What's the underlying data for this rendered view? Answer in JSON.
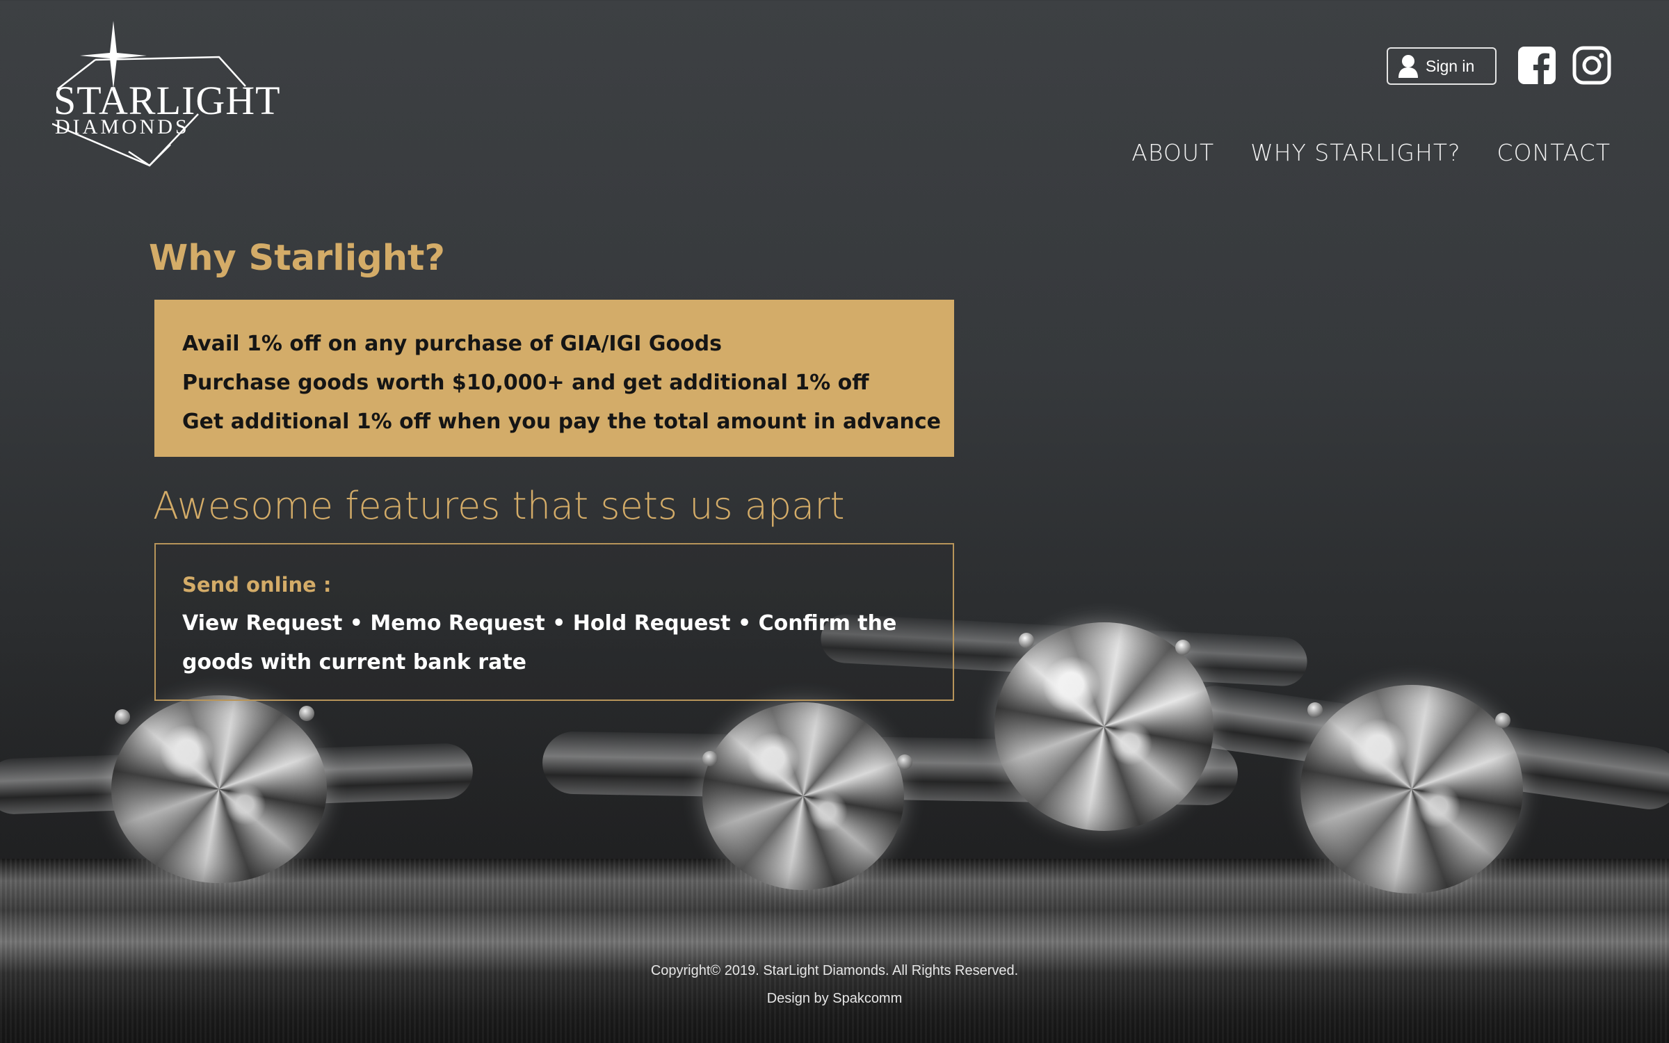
{
  "brand": {
    "title": "STARLIGHT",
    "subtitle": "DIAMONDS",
    "accent_color": "#d4ac68"
  },
  "header": {
    "signin_label": "Sign in",
    "icons": [
      "user-icon",
      "facebook-icon",
      "instagram-icon"
    ]
  },
  "nav": {
    "items": [
      {
        "label": "ABOUT"
      },
      {
        "label": "WHY STARLIGHT?"
      },
      {
        "label": "CONTACT"
      }
    ]
  },
  "main": {
    "heading": "Why Starlight?",
    "offers": [
      "Avail 1% off on any purchase of GIA/IGI Goods",
      "Purchase goods worth $10,000+ and get additional 1% off",
      "Get additional 1% off when you pay the total amount in advance"
    ],
    "offer_box_color": "#d3ac69",
    "features_title": "Awesome features that sets us apart",
    "features": {
      "label": "Send online :",
      "text": "View Request • Memo Request • Hold Request • Confirm the goods with current bank rate"
    }
  },
  "footer": {
    "copyright": "Copyright© 2019. StarLight Diamonds. All Rights Reserved.",
    "credit": "Design by Spakcomm"
  }
}
